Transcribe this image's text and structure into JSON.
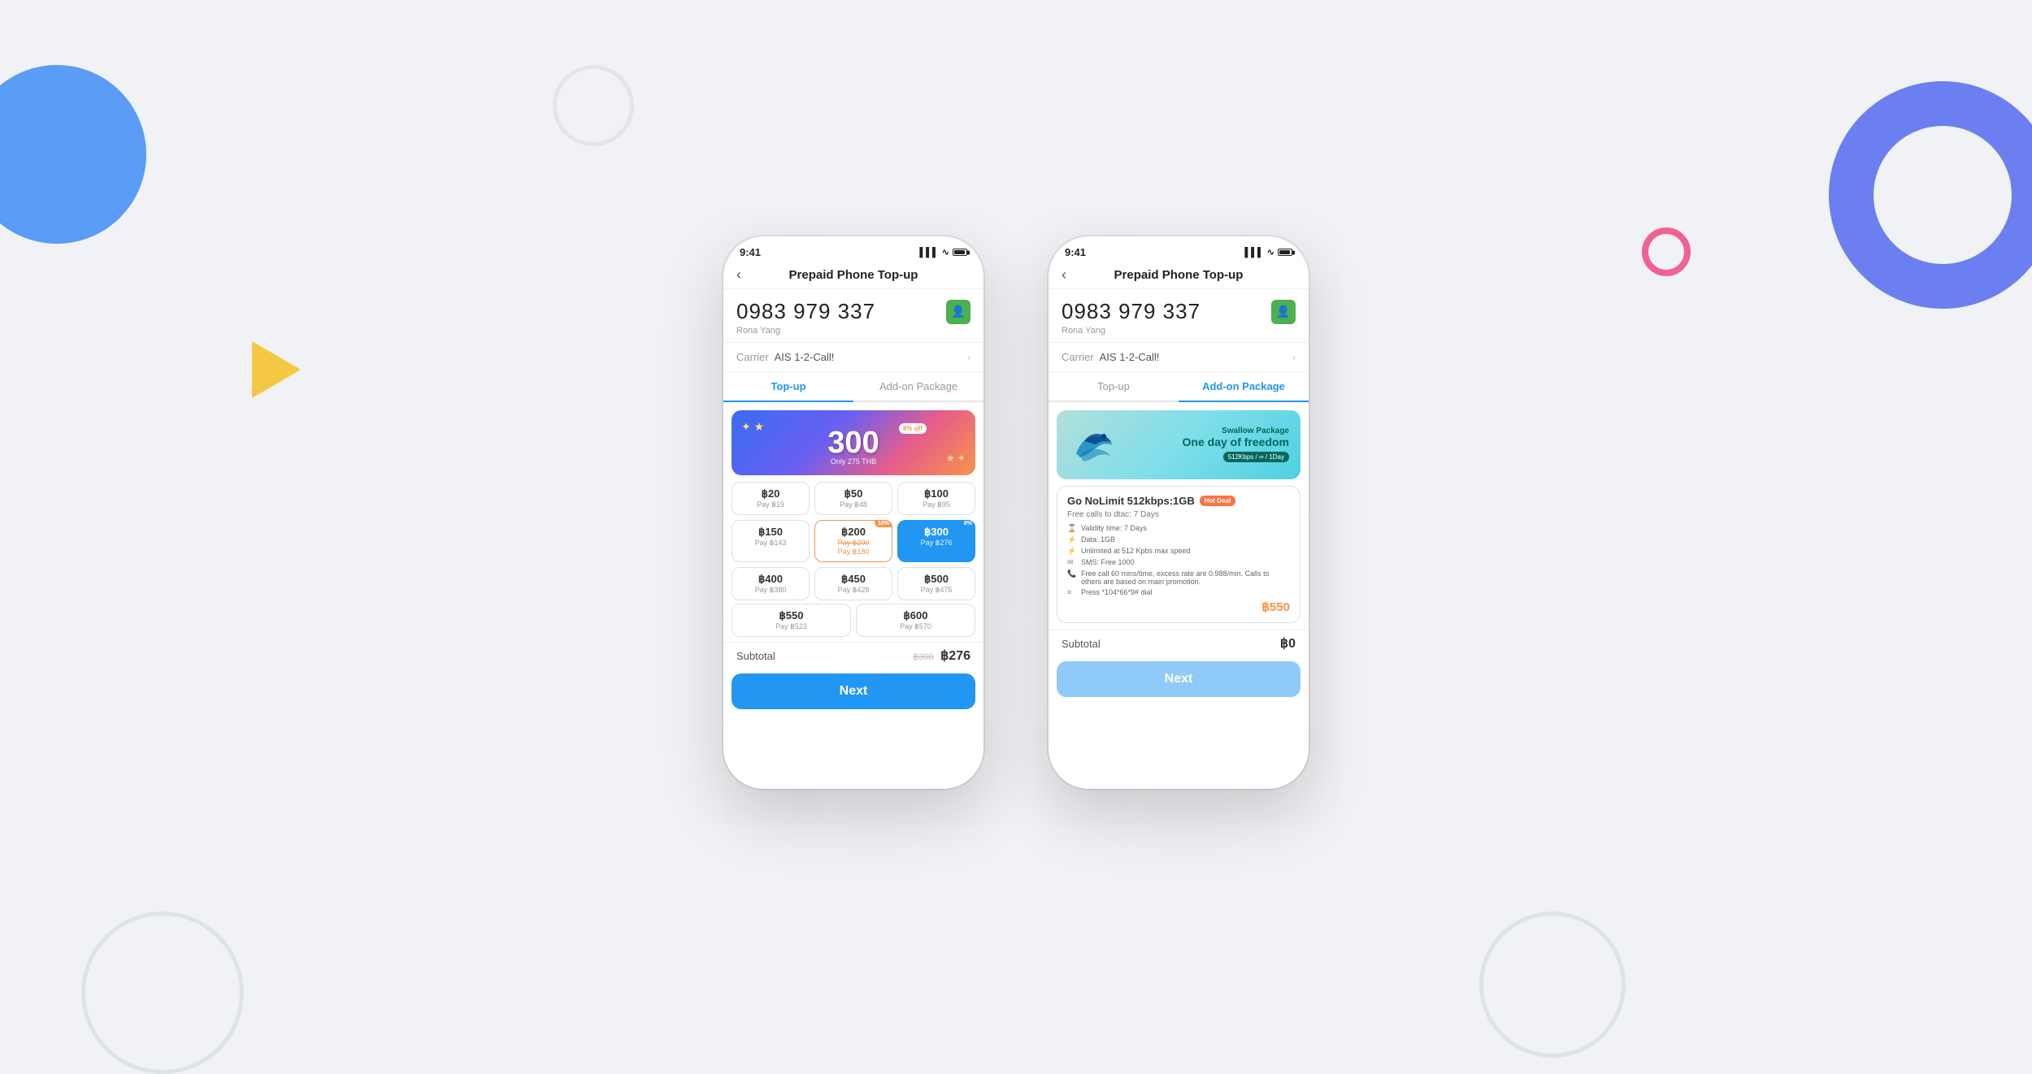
{
  "background": {
    "color": "#f0f2f5"
  },
  "left_phone": {
    "status_bar": {
      "time": "9:41"
    },
    "header": {
      "title": "Prepaid Phone Top-up",
      "back_label": "‹"
    },
    "phone_number": "0983 979 337",
    "contact_name": "Rona Yang",
    "carrier_label": "Carrier",
    "carrier_name": "AIS 1-2-Call!",
    "tabs": [
      {
        "label": "Top-up",
        "active": true
      },
      {
        "label": "Add-on Package",
        "active": false
      }
    ],
    "promo_banner": {
      "amount": "300",
      "detail": "Only 275 THB",
      "badge": "8% off"
    },
    "amounts": [
      {
        "main": "฿20",
        "pay": "Pay ฿19",
        "discount": false,
        "selected": false
      },
      {
        "main": "฿50",
        "pay": "Pay ฿48",
        "discount": false,
        "selected": false
      },
      {
        "main": "฿100",
        "pay": "Pay ฿95",
        "discount": false,
        "selected": false
      },
      {
        "main": "฿150",
        "pay": "Pay ฿143",
        "discount": false,
        "selected": false
      },
      {
        "main": "฿200",
        "pay": "Pay ฿180",
        "discount": true,
        "discount_pct": "10%",
        "selected": false
      },
      {
        "main": "฿300",
        "pay": "Pay ฿276",
        "discount": true,
        "discount_pct": "8%",
        "selected": true
      },
      {
        "main": "฿400",
        "pay": "Pay ฿380",
        "discount": false,
        "selected": false
      },
      {
        "main": "฿450",
        "pay": "Pay ฿428",
        "discount": false,
        "selected": false
      },
      {
        "main": "฿500",
        "pay": "Pay ฿475",
        "discount": false,
        "selected": false
      },
      {
        "main": "฿550",
        "pay": "Pay ฿523",
        "discount": false,
        "selected": false
      },
      {
        "main": "฿600",
        "pay": "Pay ฿570",
        "discount": false,
        "selected": false
      }
    ],
    "subtotal_label": "Subtotal",
    "subtotal_original": "฿300",
    "subtotal_amount": "฿276",
    "next_button": "Next"
  },
  "right_phone": {
    "status_bar": {
      "time": "9:41"
    },
    "header": {
      "title": "Prepaid Phone Top-up",
      "back_label": "‹"
    },
    "phone_number": "0983 979 337",
    "contact_name": "Rona Yang",
    "carrier_label": "Carrier",
    "carrier_name": "AIS 1-2-Call!",
    "tabs": [
      {
        "label": "Top-up",
        "active": false
      },
      {
        "label": "Add-on Package",
        "active": true
      }
    ],
    "addon_banner": {
      "subtitle": "Swallow Package",
      "title": "One day of\nfreedom",
      "spec": "512Kbps / ∞ / 1Day"
    },
    "package": {
      "name": "Go NoLimit 512kbps:1GB",
      "hot_deal": "Hot Deal",
      "subtitle": "Free calls to dtac: 7 Days",
      "details": [
        {
          "icon": "⌛",
          "text": "Validity time: 7 Days"
        },
        {
          "icon": "⚡",
          "text": "Data: 1GB"
        },
        {
          "icon": "⚡",
          "text": "Unlimited at 512 Kpbs max speed"
        },
        {
          "icon": "✉",
          "text": "SMS: Free 1000"
        },
        {
          "icon": "📞",
          "text": "Free call 60 mins/time, excess rate are 0.988/min.\nCalls to others are based on main promotion."
        },
        {
          "icon": "≡",
          "text": "Press *104*66*9# dial"
        }
      ],
      "price": "฿550"
    },
    "subtotal_label": "Subtotal",
    "subtotal_amount": "฿0",
    "next_button": "Next"
  }
}
